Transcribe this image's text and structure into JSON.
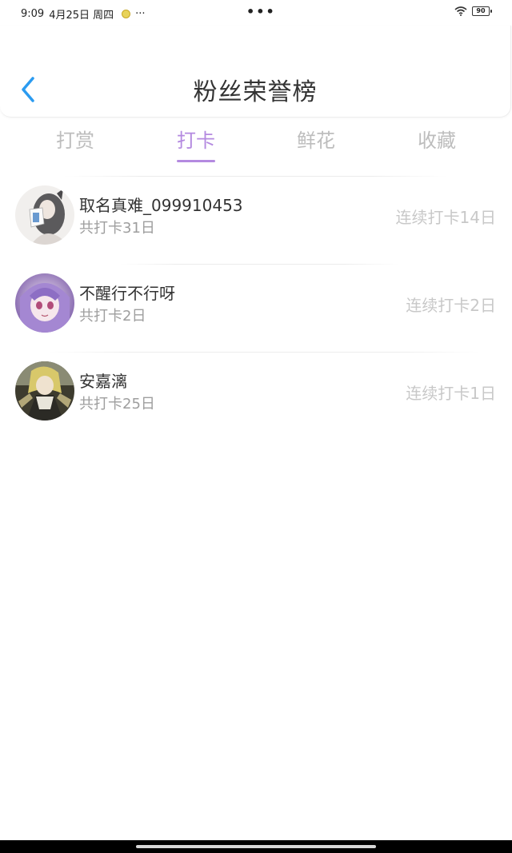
{
  "status_bar": {
    "time": "9:09",
    "date": "4月25日 周四",
    "overflow": "···",
    "center_dots": "•••",
    "battery": "90"
  },
  "header": {
    "title": "粉丝荣誉榜",
    "back_icon": "chevron-left-icon",
    "accent_color": "#2b9bf0"
  },
  "tabs": [
    {
      "label": "打赏",
      "active": false
    },
    {
      "label": "打卡",
      "active": true
    },
    {
      "label": "鲜花",
      "active": false
    },
    {
      "label": "收藏",
      "active": false
    }
  ],
  "active_tab_color": "#b48ae0",
  "fans": [
    {
      "name": "取名真难_099910453",
      "total": "共打卡31日",
      "streak": "连续打卡14日"
    },
    {
      "name": "不醒行不行呀",
      "total": "共打卡2日",
      "streak": "连续打卡2日"
    },
    {
      "name": "安嘉漓",
      "total": "共打卡25日",
      "streak": "连续打卡1日"
    }
  ]
}
